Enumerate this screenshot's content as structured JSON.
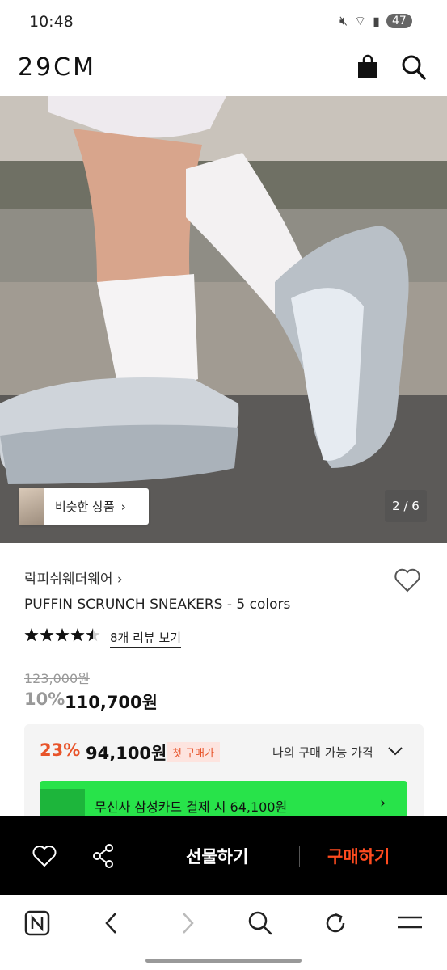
{
  "status": {
    "time": "10:48",
    "battery": "47"
  },
  "header": {
    "logo": "29CM",
    "cart_icon": "shopping-bag-icon",
    "search_icon": "search-icon"
  },
  "hero": {
    "similar_label": "비슷한 상품",
    "pager": "2 / 6"
  },
  "product": {
    "brand": "락피쉬웨더웨어",
    "title": "PUFFIN SCRUNCH SNEAKERS - 5 colors",
    "rating": 4.5,
    "review_link": "8개 리뷰 보기",
    "original_price": "123,000원",
    "discount": "10%",
    "price": "110,700원"
  },
  "benefit": {
    "discount": "23%",
    "price": "94,100원",
    "badge": "첫 구매가",
    "my_price": "나의 구매 가능 가격",
    "card_offer": "무신사 삼성카드 결제 시 64,100원"
  },
  "buy_bar": {
    "gift": "선물하기",
    "buy": "구매하기"
  },
  "colors": {
    "accent": "#e8542a",
    "buy": "#ff4b1f",
    "card_banner": "#28e34a"
  }
}
